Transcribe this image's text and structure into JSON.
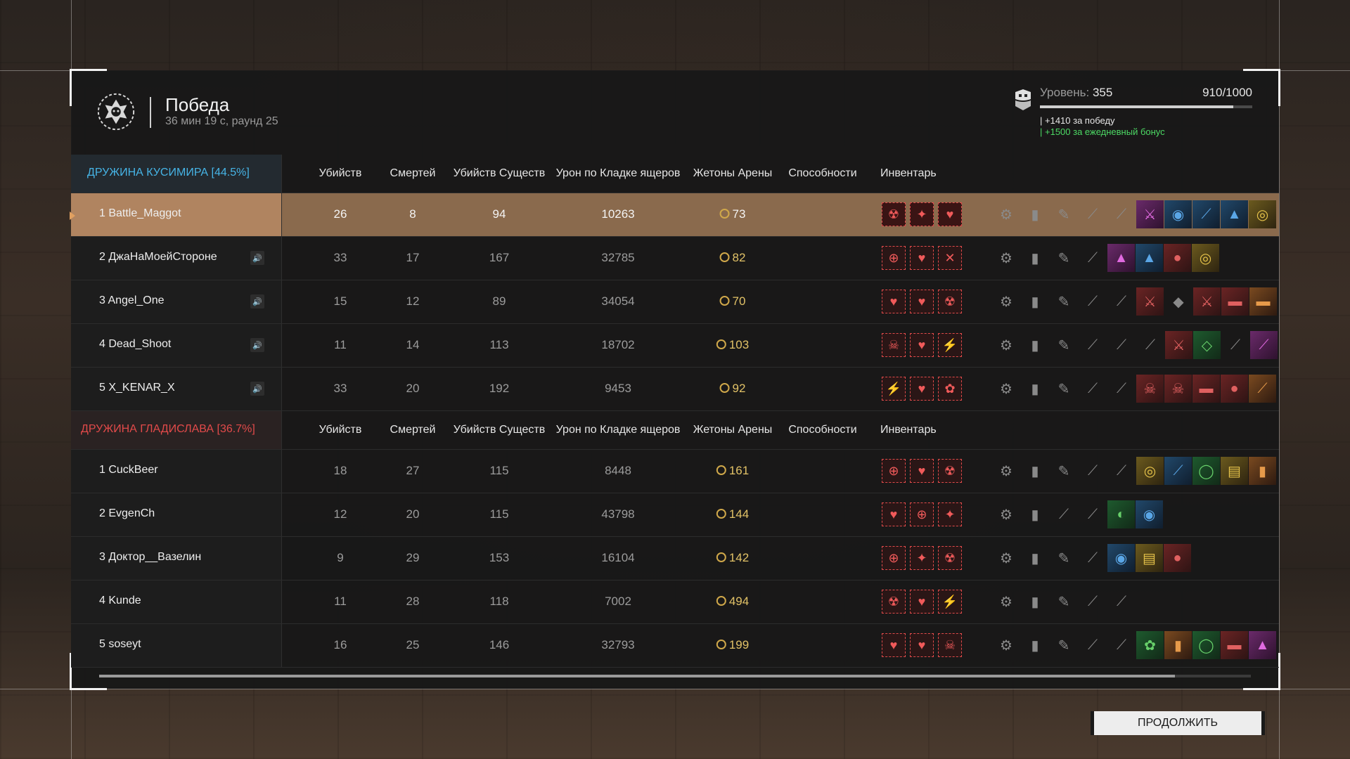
{
  "header": {
    "title": "Победа",
    "subtitle": "36 мин 19 с, раунд 25"
  },
  "level": {
    "label": "Уровень:",
    "value": "355",
    "xp": "910/1000",
    "progress": 0.91,
    "bonus_win": "+1410 за победу",
    "bonus_daily": "+1500 за ежедневный бонус"
  },
  "columns": [
    "Убийств",
    "Смертей",
    "Убийств Существ",
    "Урон по Кладке ящеров",
    "Жетоны Арены",
    "Способности",
    "Инвентарь"
  ],
  "team1": {
    "name": "ДРУЖИНА КУСИМИРА [44.5%]",
    "players": [
      {
        "name": "1 Battle_Maggot",
        "kills": "26",
        "deaths": "8",
        "creatures": "94",
        "damage": "10263",
        "tokens": "73"
      },
      {
        "name": "2 ДжаНаМоейСтороне",
        "kills": "33",
        "deaths": "17",
        "creatures": "167",
        "damage": "32785",
        "tokens": "82"
      },
      {
        "name": "3 Angel_One",
        "kills": "15",
        "deaths": "12",
        "creatures": "89",
        "damage": "34054",
        "tokens": "70"
      },
      {
        "name": "4 Dead_Shoot",
        "kills": "11",
        "deaths": "14",
        "creatures": "113",
        "damage": "18702",
        "tokens": "103"
      },
      {
        "name": "5 X_KENAR_X",
        "kills": "33",
        "deaths": "20",
        "creatures": "192",
        "damage": "9453",
        "tokens": "92"
      }
    ]
  },
  "team2": {
    "name": "ДРУЖИНА ГЛАДИСЛАВА [36.7%]",
    "players": [
      {
        "name": "1 CuckBeer",
        "kills": "18",
        "deaths": "27",
        "creatures": "115",
        "damage": "8448",
        "tokens": "161"
      },
      {
        "name": "2 EvgenCh",
        "kills": "12",
        "deaths": "20",
        "creatures": "115",
        "damage": "43798",
        "tokens": "144"
      },
      {
        "name": "3 Доктор__Вазелин",
        "kills": "9",
        "deaths": "29",
        "creatures": "153",
        "damage": "16104",
        "tokens": "142"
      },
      {
        "name": "4 Kunde",
        "kills": "11",
        "deaths": "28",
        "creatures": "118",
        "damage": "7002",
        "tokens": "494"
      },
      {
        "name": "5 soseyt",
        "kills": "16",
        "deaths": "25",
        "creatures": "146",
        "damage": "32793",
        "tokens": "199"
      }
    ]
  },
  "continue_label": "ПРОДОЛЖИТЬ",
  "colors": {
    "team1": "#46b4e6",
    "team2": "#e24a4a",
    "accent": "#e14b4b",
    "highlight": "#b08460",
    "bonus": "#4cd964"
  }
}
